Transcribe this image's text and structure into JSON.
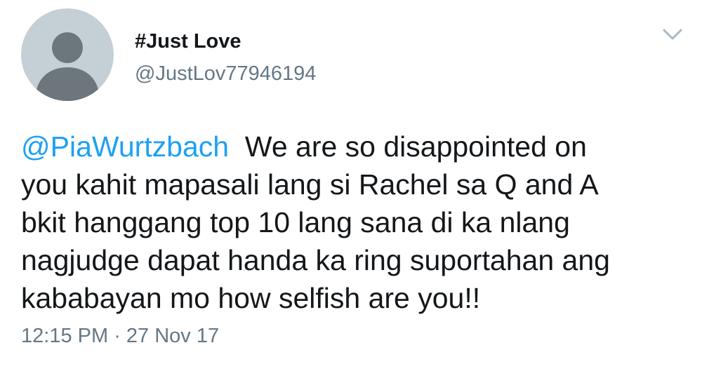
{
  "tweet": {
    "display_name": "#Just Love",
    "handle": "@JustLov77946194",
    "mention": "@PiaWurtzbach",
    "text_line1": "  We are so disappointed on",
    "text_rest": "you kahit mapasali lang si Rachel sa Q and A\nbkit hanggang top 10 lang sana di ka nlang\nnagjudge dapat handa ka ring suportahan ang\nkababayan mo how selfish are you!!",
    "time": "12:15 PM",
    "separator": " · ",
    "date": "27 Nov 17"
  },
  "icons": {
    "avatar": "default-avatar-icon",
    "menu": "chevron-down-icon"
  },
  "colors": {
    "mention": "#1da1f2",
    "secondary_text": "#657786",
    "avatar_bg": "#c4cfd6",
    "avatar_figure": "#6e767d"
  }
}
